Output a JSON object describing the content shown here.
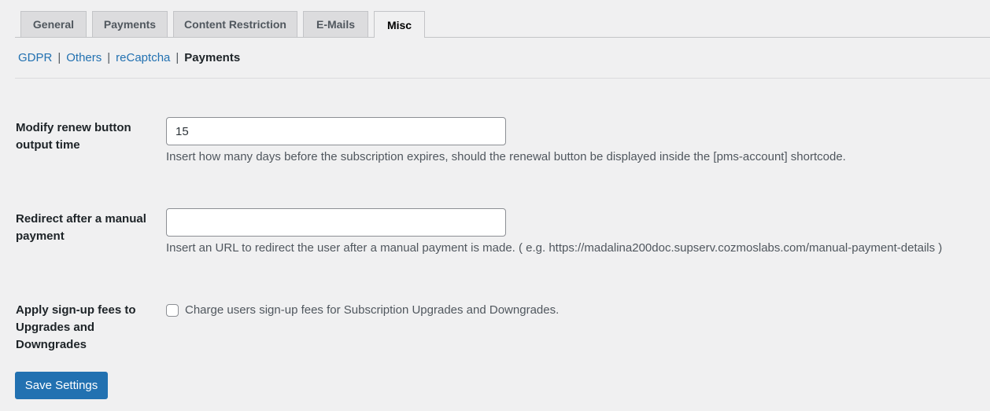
{
  "tabs": [
    {
      "label": "General"
    },
    {
      "label": "Payments"
    },
    {
      "label": "Content Restriction"
    },
    {
      "label": "E-Mails"
    },
    {
      "label": "Misc"
    }
  ],
  "active_tab": "Misc",
  "subnav": {
    "items": [
      {
        "label": "GDPR"
      },
      {
        "label": "Others"
      },
      {
        "label": "reCaptcha"
      },
      {
        "label": "Payments"
      }
    ],
    "separator": "|",
    "current": "Payments"
  },
  "fields": {
    "renew_button": {
      "label": "Modify renew button output time",
      "value": "15",
      "description": "Insert how many days before the subscription expires, should the renewal button be displayed inside the [pms-account] shortcode."
    },
    "redirect_manual_payment": {
      "label": "Redirect after a manual payment",
      "value": "",
      "description": "Insert an URL to redirect the user after a manual payment is made. ( e.g. https://madalina200doc.supserv.cozmoslabs.com/manual-payment-details )"
    },
    "signup_fees": {
      "label": "Apply sign-up fees to Upgrades and Downgrades",
      "checkbox_label": "Charge users sign-up fees for Subscription Upgrades and Downgrades.",
      "checked": false
    }
  },
  "save_button": {
    "label": "Save Settings"
  },
  "colors": {
    "accent": "#2271b1",
    "background": "#f0f0f1"
  }
}
